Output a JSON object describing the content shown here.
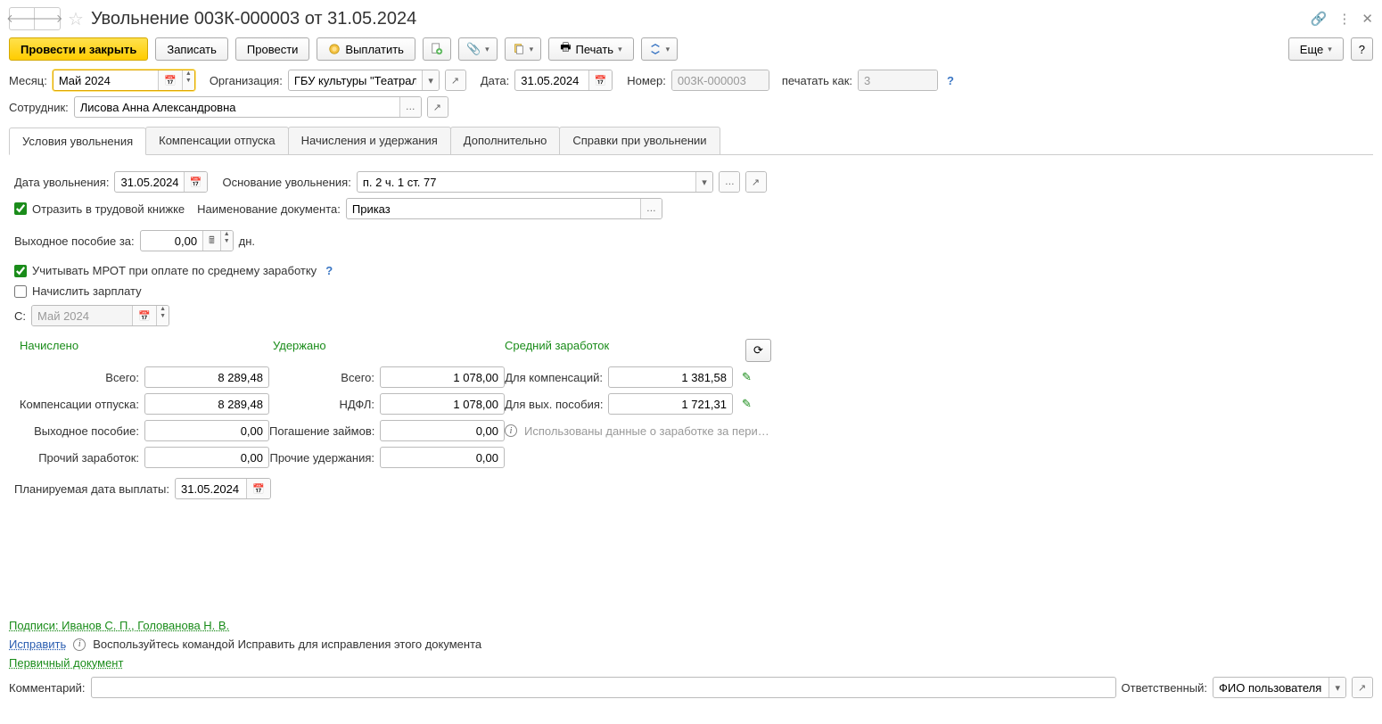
{
  "window": {
    "title": "Увольнение 003К-000003 от 31.05.2024"
  },
  "toolbar": {
    "post_and_close": "Провести и закрыть",
    "write": "Записать",
    "post": "Провести",
    "pay": "Выплатить",
    "print": "Печать",
    "more": "Еще",
    "help": "?"
  },
  "header": {
    "month_label": "Месяц:",
    "month_value": "Май 2024",
    "org_label": "Организация:",
    "org_value": "ГБУ культуры \"Театральны",
    "date_label": "Дата:",
    "date_value": "31.05.2024",
    "number_label": "Номер:",
    "number_value": "003К-000003",
    "print_as_label": "печатать как:",
    "print_as_value": "3",
    "employee_label": "Сотрудник:",
    "employee_value": "Лисова Анна Александровна"
  },
  "tabs": {
    "conditions": "Условия увольнения",
    "vacation_comp": "Компенсации отпуска",
    "accruals": "Начисления и удержания",
    "additional": "Дополнительно",
    "certificates": "Справки при увольнении"
  },
  "conditions": {
    "dismissal_date_label": "Дата увольнения:",
    "dismissal_date_value": "31.05.2024",
    "basis_label": "Основание увольнения:",
    "basis_value": "п. 2 ч. 1 ст. 77",
    "reflect_workbook": "Отразить в трудовой книжке",
    "doc_name_label": "Наименование документа:",
    "doc_name_value": "Приказ",
    "severance_label": "Выходное пособие за:",
    "severance_value": "0,00",
    "severance_days": "дн.",
    "mrot_label": "Учитывать МРОТ при оплате по среднему заработку",
    "accrue_salary_label": "Начислить зарплату",
    "from_label": "С:",
    "from_value": "Май 2024"
  },
  "calc": {
    "accrued_header": "Начислено",
    "withheld_header": "Удержано",
    "avg_header": "Средний заработок",
    "accrued": {
      "total_label": "Всего:",
      "total_value": "8 289,48",
      "vacation_label": "Компенсации отпуска:",
      "vacation_value": "8 289,48",
      "severance_label": "Выходное пособие:",
      "severance_value": "0,00",
      "other_label": "Прочий заработок:",
      "other_value": "0,00"
    },
    "withheld": {
      "total_label": "Всего:",
      "total_value": "1 078,00",
      "ndfl_label": "НДФЛ:",
      "ndfl_value": "1 078,00",
      "loans_label": "Погашение займов:",
      "loans_value": "0,00",
      "other_label": "Прочие удержания:",
      "other_value": "0,00"
    },
    "avg": {
      "comp_label": "Для компенсаций:",
      "comp_value": "1 381,58",
      "sev_label": "Для вых. пособия:",
      "sev_value": "1 721,31",
      "info_text": "Использованы данные о заработке за пери…"
    },
    "planned_date_label": "Планируемая дата выплаты:",
    "planned_date_value": "31.05.2024"
  },
  "footer": {
    "signatures": "Подписи: Иванов С. П., Голованова Н. В.",
    "correct": "Исправить",
    "correct_hint": "Воспользуйтесь командой Исправить для исправления этого документа",
    "primary_doc": "Первичный документ",
    "comment_label": "Комментарий:",
    "comment_value": "",
    "responsible_label": "Ответственный:",
    "responsible_value": "ФИО пользователя"
  }
}
